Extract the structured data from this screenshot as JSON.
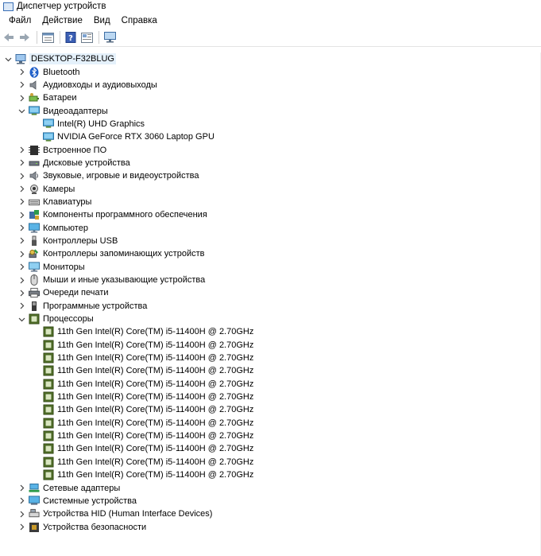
{
  "window": {
    "title": "Диспетчер устройств"
  },
  "menu": [
    "Файл",
    "Действие",
    "Вид",
    "Справка"
  ],
  "toolbar": [
    "back-icon",
    "forward-icon",
    "properties-icon",
    "help-icon",
    "update-driver-icon",
    "monitor-scan-icon"
  ],
  "tree": {
    "root": "DESKTOP-F32BLUG",
    "categories": [
      {
        "label": "Bluetooth",
        "icon": "bluetooth-icon",
        "expanded": false
      },
      {
        "label": "Аудиовходы и аудиовыходы",
        "icon": "speaker-icon",
        "expanded": false
      },
      {
        "label": "Батареи",
        "icon": "battery-icon",
        "expanded": false
      },
      {
        "label": "Видеоадаптеры",
        "icon": "display-adapter-icon",
        "expanded": true,
        "children": [
          "Intel(R) UHD Graphics",
          "NVIDIA GeForce RTX 3060 Laptop GPU"
        ]
      },
      {
        "label": "Встроенное ПО",
        "icon": "firmware-icon",
        "expanded": false
      },
      {
        "label": "Дисковые устройства",
        "icon": "disk-icon",
        "expanded": false
      },
      {
        "label": "Звуковые, игровые и видеоустройства",
        "icon": "sound-icon",
        "expanded": false
      },
      {
        "label": "Камеры",
        "icon": "camera-icon",
        "expanded": false
      },
      {
        "label": "Клавиатуры",
        "icon": "keyboard-icon",
        "expanded": false
      },
      {
        "label": "Компоненты программного обеспечения",
        "icon": "software-component-icon",
        "expanded": false
      },
      {
        "label": "Компьютер",
        "icon": "computer-icon",
        "expanded": false
      },
      {
        "label": "Контроллеры USB",
        "icon": "usb-icon",
        "expanded": false
      },
      {
        "label": "Контроллеры запоминающих устройств",
        "icon": "storage-controller-icon",
        "expanded": false
      },
      {
        "label": "Мониторы",
        "icon": "monitor-icon",
        "expanded": false
      },
      {
        "label": "Мыши и иные указывающие устройства",
        "icon": "mouse-icon",
        "expanded": false
      },
      {
        "label": "Очереди печати",
        "icon": "printer-icon",
        "expanded": false
      },
      {
        "label": "Программные устройства",
        "icon": "software-device-icon",
        "expanded": false
      },
      {
        "label": "Процессоры",
        "icon": "processor-icon",
        "expanded": true,
        "children": [
          "11th Gen Intel(R) Core(TM) i5-11400H @ 2.70GHz",
          "11th Gen Intel(R) Core(TM) i5-11400H @ 2.70GHz",
          "11th Gen Intel(R) Core(TM) i5-11400H @ 2.70GHz",
          "11th Gen Intel(R) Core(TM) i5-11400H @ 2.70GHz",
          "11th Gen Intel(R) Core(TM) i5-11400H @ 2.70GHz",
          "11th Gen Intel(R) Core(TM) i5-11400H @ 2.70GHz",
          "11th Gen Intel(R) Core(TM) i5-11400H @ 2.70GHz",
          "11th Gen Intel(R) Core(TM) i5-11400H @ 2.70GHz",
          "11th Gen Intel(R) Core(TM) i5-11400H @ 2.70GHz",
          "11th Gen Intel(R) Core(TM) i5-11400H @ 2.70GHz",
          "11th Gen Intel(R) Core(TM) i5-11400H @ 2.70GHz",
          "11th Gen Intel(R) Core(TM) i5-11400H @ 2.70GHz"
        ]
      },
      {
        "label": "Сетевые адаптеры",
        "icon": "network-adapter-icon",
        "expanded": false
      },
      {
        "label": "Системные устройства",
        "icon": "system-device-icon",
        "expanded": false
      },
      {
        "label": "Устройства HID (Human Interface Devices)",
        "icon": "hid-icon",
        "expanded": false
      },
      {
        "label": "Устройства безопасности",
        "icon": "security-device-icon",
        "expanded": false
      }
    ]
  }
}
